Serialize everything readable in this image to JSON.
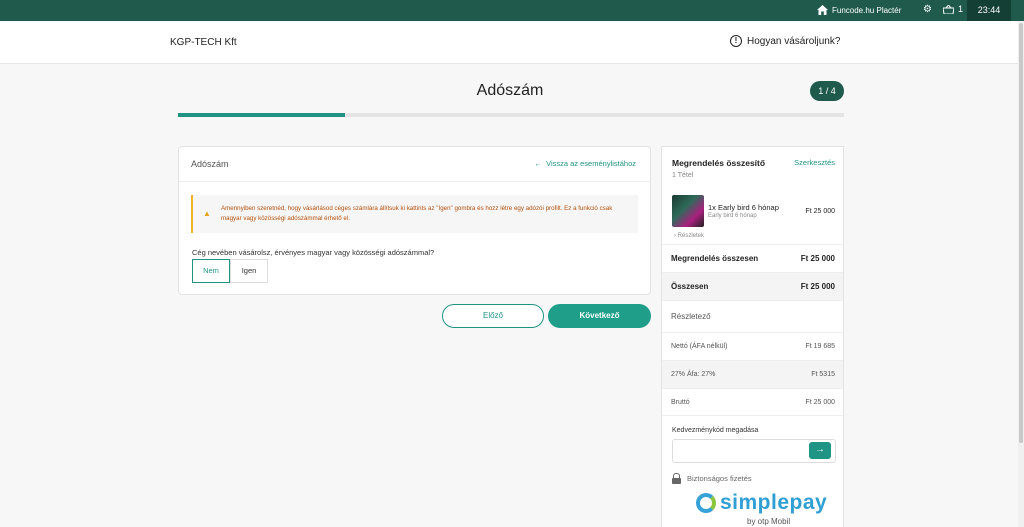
{
  "topbar": {
    "site_label": "Funcode.hu Plactér",
    "cart_count": "1",
    "time": "23:44"
  },
  "header": {
    "brand": "KGP-TECH Kft",
    "help_label": "Hogyan vásároljunk?"
  },
  "page": {
    "title": "Adószám",
    "step": "1 / 4",
    "progress": 0.25
  },
  "form": {
    "card_title": "Adószám",
    "back_link": "Vissza az eseménylistához",
    "warning": "Amennyiben szeretnéd, hogy vásárlásod céges számlára állítsuk ki kattints az \"Igen\" gombra és hozz létre egy adózói profilt. Ez a funkció csak magyar vagy közösségi adószámmal érhető el.",
    "question": "Cég nevében vásárolsz, érvényes magyar vagy közösségi adószámmal?",
    "options": [
      "Nem",
      "Igen"
    ],
    "selected": "Nem"
  },
  "buttons": {
    "prev": "Előző",
    "next": "Következő"
  },
  "summary": {
    "title": "Megrendelés összesítő",
    "edit": "Szerkesztés",
    "count": "1 Tétel",
    "item": {
      "name": "1x Early bird 6 hónap",
      "sub": "Early bird 6 hónap",
      "price": "Ft 25 000",
      "details": "Részletek"
    },
    "order_total_label": "Megrendelés összesen",
    "order_total": "Ft 25 000",
    "total_label": "Összesen",
    "total": "Ft 25 000",
    "breakdown_label": "Részletező",
    "net_label": "Nettó (ÁFA nélkül)",
    "net": "Ft 19 685",
    "vat_label": "27% Áfa: 27%",
    "vat": "Ft 5315",
    "gross_label": "Bruttó",
    "gross": "Ft 25 000",
    "coupon_label": "Kedvezménykód megadása",
    "secure_label": "Biztonságos fizetés",
    "simplepay_text": "simplepay",
    "simplepay_by": "by otp Mobil"
  },
  "icons": {
    "home": "home-icon",
    "gear": "gear-icon",
    "cart": "cart-icon",
    "info": "info-icon",
    "warning": "warning-icon",
    "arrow-left": "arrow-left-icon",
    "arrow-right": "arrow-right-icon",
    "lock": "lock-icon"
  },
  "colors": {
    "accent": "#1f9484",
    "topbar": "#1f5a4c",
    "warning": "#f0b428"
  }
}
